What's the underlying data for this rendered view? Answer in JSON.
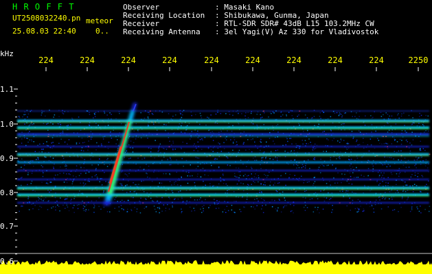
{
  "logo": "H R O F F T",
  "file_name": "UT2508032240.pn",
  "mode_label": "meteor",
  "datetime": "25.08.03 22:40",
  "counter": "0..",
  "info_labels": [
    "Observer",
    "Receiving Location",
    "Receiver",
    "Receiving Antenna"
  ],
  "info_values": [
    ": Masaki Kano",
    ": Shibukawa, Gunma, Japan",
    ": RTL-SDR SDR# 43dB L15 103.2MHz CW",
    ": 3el Yagi(V) Az 330 for Vladivostok"
  ],
  "axis": {
    "unit": "kHz",
    "y_ticks": [
      "1.1",
      "1.0",
      "0.9",
      "0.8",
      "0.7",
      "0.6"
    ],
    "x_ticks": [
      "224",
      "224",
      "224",
      "224",
      "224",
      "224",
      "224",
      "224",
      "224",
      "2250"
    ]
  },
  "colors": {
    "background": "#000000",
    "text_white": "#ffffff",
    "text_yellow": "#ffff00",
    "logo_green": "#00ff00",
    "signal_blue": "#1a2cff",
    "signal_cyan": "#00e0ff",
    "signal_green": "#40ff40",
    "signal_red": "#ff2020",
    "noise_yellow": "#ffff00"
  }
}
